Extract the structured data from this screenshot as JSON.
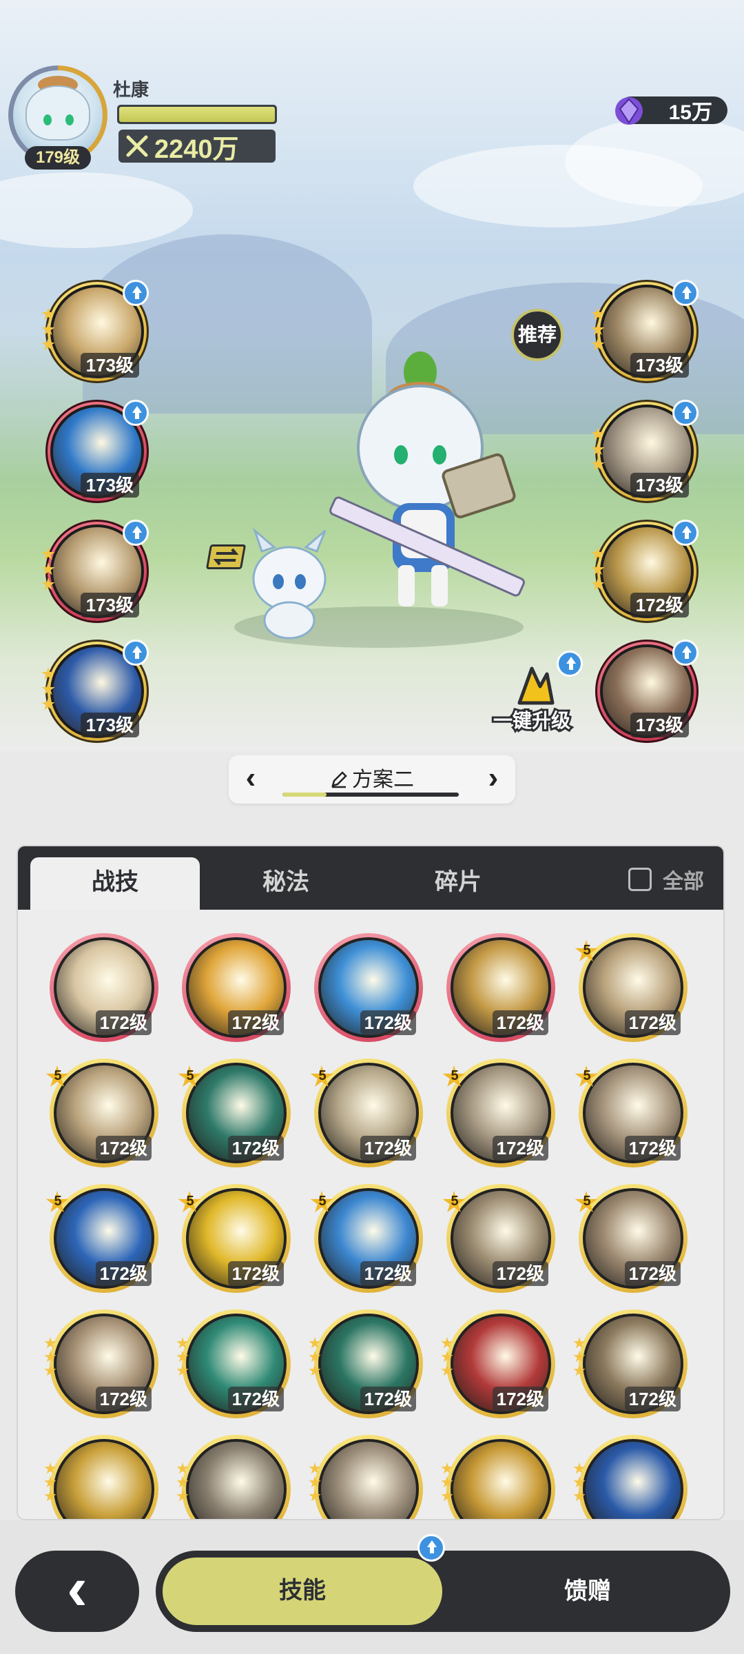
{
  "player": {
    "name": "杜康",
    "level": "179级",
    "xp_fraction": 1.0,
    "power": "2240万",
    "currency": "15万"
  },
  "left_slots": [
    {
      "level": "173级",
      "rarity": "gold",
      "stars": 3,
      "icon": "starburst-skill-icon"
    },
    {
      "level": "173级",
      "rarity": "red",
      "stars": 0,
      "icon": "ice-shield-skill-icon"
    },
    {
      "level": "173级",
      "rarity": "red",
      "stars": 3,
      "icon": "wind-slash-skill-icon"
    },
    {
      "level": "173级",
      "rarity": "gold",
      "stars": 3,
      "icon": "blue-star-skill-icon"
    }
  ],
  "right_slots": [
    {
      "level": "173级",
      "rarity": "gold",
      "stars": 3,
      "icon": "sword-strike-skill-icon"
    },
    {
      "level": "173级",
      "rarity": "gold",
      "stars": 3,
      "icon": "whirlwind-skill-icon"
    },
    {
      "level": "172级",
      "rarity": "gold",
      "stars": 3,
      "icon": "shield-skill-icon"
    },
    {
      "level": "173级",
      "rarity": "red",
      "stars": 0,
      "icon": "heart-skill-icon"
    }
  ],
  "recommend_label": "推荐",
  "onekey_label": "一键升级",
  "plan": {
    "label": "方案二",
    "prev": "‹",
    "next": "›",
    "progress_fraction": 0.25
  },
  "tabs": {
    "combat": "战技",
    "secret": "秘法",
    "fragment": "碎片",
    "all": "全部"
  },
  "grid": [
    {
      "level": "172级",
      "rarity": "red",
      "badge": "",
      "stars": 0,
      "tone": "#d9c6a2",
      "icon": "fist-burst-skill-icon"
    },
    {
      "level": "172级",
      "rarity": "red",
      "badge": "",
      "stars": 0,
      "tone": "#e0a53a",
      "icon": "lightning-strike-skill-icon"
    },
    {
      "level": "172级",
      "rarity": "red",
      "badge": "",
      "stars": 0,
      "tone": "#3e8fd6",
      "icon": "water-wave-skill-icon"
    },
    {
      "level": "172级",
      "rarity": "red",
      "badge": "",
      "stars": 0,
      "tone": "#c49a47",
      "icon": "spear-rain-skill-icon"
    },
    {
      "level": "172级",
      "rarity": "gold",
      "badge": "5",
      "stars": 0,
      "tone": "#b9a27c",
      "icon": "blade-flash-skill-icon"
    },
    {
      "level": "172级",
      "rarity": "gold",
      "badge": "5",
      "stars": 0,
      "tone": "#b9a27c",
      "icon": "spin-slash-skill-icon"
    },
    {
      "level": "172级",
      "rarity": "gold",
      "badge": "5",
      "stars": 0,
      "tone": "#2f7a6a",
      "icon": "green-dash-skill-icon"
    },
    {
      "level": "172级",
      "rarity": "gold",
      "badge": "5",
      "stars": 0,
      "tone": "#b6a88a",
      "icon": "ground-spikes-skill-icon"
    },
    {
      "level": "172级",
      "rarity": "gold",
      "badge": "5",
      "stars": 0,
      "tone": "#a89a84",
      "icon": "tornado-skill-icon"
    },
    {
      "level": "172级",
      "rarity": "gold",
      "badge": "5",
      "stars": 0,
      "tone": "#a8967e",
      "icon": "leap-attack-skill-icon"
    },
    {
      "level": "172级",
      "rarity": "gold",
      "badge": "5",
      "stars": 0,
      "tone": "#2d66b8",
      "icon": "blue-shatter-skill-icon"
    },
    {
      "level": "172级",
      "rarity": "gold",
      "badge": "5",
      "stars": 0,
      "tone": "#e0b82a",
      "icon": "golden-rise-skill-icon"
    },
    {
      "level": "172级",
      "rarity": "gold",
      "badge": "5",
      "stars": 0,
      "tone": "#3c87d0",
      "icon": "ice-crystal-skill-icon"
    },
    {
      "level": "172级",
      "rarity": "gold",
      "badge": "5",
      "stars": 0,
      "tone": "#9c8c72",
      "icon": "slash-arc-skill-icon"
    },
    {
      "level": "172级",
      "rarity": "gold",
      "badge": "5",
      "stars": 0,
      "tone": "#9e8a72",
      "icon": "charge-skill-icon"
    },
    {
      "level": "172级",
      "rarity": "gold",
      "badge": "",
      "stars": 3,
      "tone": "#a89276",
      "icon": "crescent-swing-skill-icon"
    },
    {
      "level": "172级",
      "rarity": "gold",
      "badge": "",
      "stars": 3,
      "tone": "#2f8a76",
      "icon": "web-net-skill-icon"
    },
    {
      "level": "172级",
      "rarity": "gold",
      "badge": "",
      "stars": 3,
      "tone": "#2c7664",
      "icon": "jade-sword-skill-icon"
    },
    {
      "level": "172级",
      "rarity": "gold",
      "badge": "",
      "stars": 3,
      "tone": "#b23a3a",
      "icon": "crimson-blade-skill-icon"
    },
    {
      "level": "172级",
      "rarity": "gold",
      "badge": "",
      "stars": 3,
      "tone": "#8c7a5e",
      "icon": "burst-impact-skill-icon"
    },
    {
      "level": "",
      "rarity": "gold",
      "badge": "",
      "stars": 3,
      "tone": "#c9a03a",
      "icon": "rune-up-skill-icon"
    },
    {
      "level": "",
      "rarity": "gold",
      "badge": "",
      "stars": 3,
      "tone": "#8a8070",
      "icon": "swift-wind-skill-icon"
    },
    {
      "level": "",
      "rarity": "gold",
      "badge": "",
      "stars": 3,
      "tone": "#9c8e7a",
      "icon": "stone-fist-skill-icon"
    },
    {
      "level": "",
      "rarity": "gold",
      "badge": "",
      "stars": 3,
      "tone": "#c89a36",
      "icon": "gold-flame-skill-icon"
    },
    {
      "level": "",
      "rarity": "gold",
      "badge": "",
      "stars": 3,
      "tone": "#2a5aa8",
      "icon": "blue-orb-skill-icon"
    }
  ],
  "bottom_nav": {
    "back": "‹",
    "skills": "技能",
    "gifts": "馈赠"
  }
}
